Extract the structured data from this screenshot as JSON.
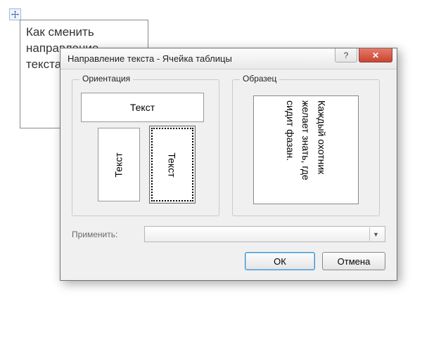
{
  "table": {
    "cell_text": "Как сменить направление текста?"
  },
  "dialog": {
    "title": "Направление текста - Ячейка таблицы",
    "help_icon": "?",
    "close_icon": "✕",
    "panels": {
      "orientation_label": "Ориентация",
      "sample_label": "Образец"
    },
    "orientation": {
      "horizontal": "Текст",
      "vertical_left": "Текст",
      "vertical_right": "Текст",
      "selected": "vertical_right"
    },
    "sample": {
      "text": "Каждый охотник желает знать, где сидит фазан."
    },
    "apply": {
      "label": "Применить:",
      "value": ""
    },
    "buttons": {
      "ok": "ОК",
      "cancel": "Отмена"
    }
  }
}
